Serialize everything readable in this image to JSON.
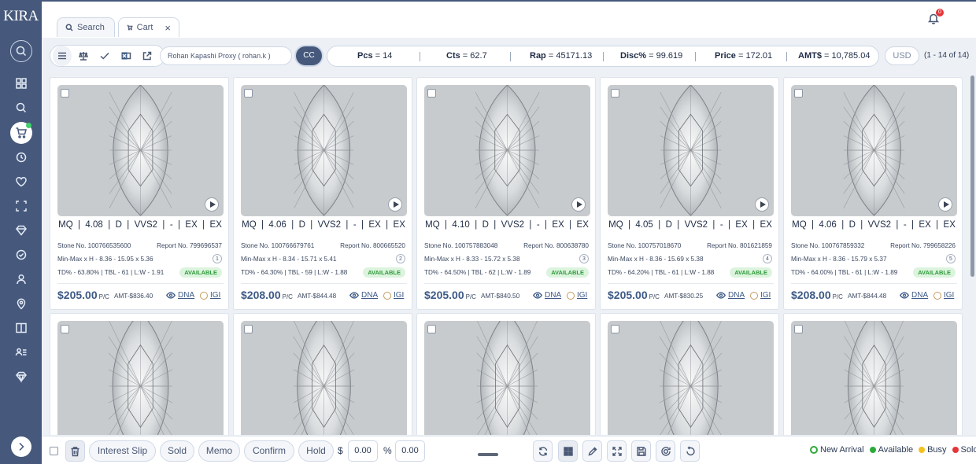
{
  "app": {
    "logo": "KIRA"
  },
  "tabs": [
    {
      "label": "Search"
    },
    {
      "label": "Cart"
    }
  ],
  "notifications": {
    "count": "0"
  },
  "toolbar": {
    "proxy_user": "Rohan Kapashi Proxy ( rohan.k )",
    "cc_label": "CC",
    "currency": "USD",
    "range": "(1 - 14 of 14)"
  },
  "summary": [
    {
      "label": "Pcs",
      "value": "14"
    },
    {
      "label": "Cts",
      "value": "62.7"
    },
    {
      "label": "Rap",
      "value": "45171.13"
    },
    {
      "label": "Disc%",
      "value": "99.619"
    },
    {
      "label": "Price",
      "value": "172.01"
    },
    {
      "label": "AMT$",
      "value": "10,785.04"
    }
  ],
  "cards": [
    {
      "spec": "MQ  |  4.08  |  D  |  VVS2  |  -  |  EX  |  EX",
      "stone": "Stone No. 100766535600",
      "report": "Report No. 799696537",
      "minmax": "Min-Max x H - 8.36 - 15.95 x 5.36",
      "index": "1",
      "td": "TD% - 63.80% | TBL - 61 | L:W - 1.91",
      "status": "AVAILABLE",
      "price": "$205.00",
      "pc": "P/C",
      "amt": "AMT-$836.40",
      "dna": "DNA",
      "lab": "IGI"
    },
    {
      "spec": "MQ  |  4.06  |  D  |  VVS2  |  -  |  EX  |  EX",
      "stone": "Stone No. 100766679761",
      "report": "Report No. 800665520",
      "minmax": "Min-Max x H - 8.34 - 15.71 x 5.41",
      "index": "2",
      "td": "TD% - 64.30% | TBL - 59 | L:W - 1.88",
      "status": "AVAILABLE",
      "price": "$208.00",
      "pc": "P/C",
      "amt": "AMT-$844.48",
      "dna": "DNA",
      "lab": "IGI"
    },
    {
      "spec": "MQ  |  4.10  |  D  |  VVS2  |  -  |  EX  |  EX",
      "stone": "Stone No. 100757883048",
      "report": "Report No. 800638780",
      "minmax": "Min-Max x H - 8.33 - 15.72 x 5.38",
      "index": "3",
      "td": "TD% - 64.50% | TBL - 62 | L:W - 1.89",
      "status": "AVAILABLE",
      "price": "$205.00",
      "pc": "P/C",
      "amt": "AMT-$840.50",
      "dna": "DNA",
      "lab": "IGI"
    },
    {
      "spec": "MQ  |  4.05  |  D  |  VVS2  |  -  |  EX  |  EX",
      "stone": "Stone No. 100757018670",
      "report": "Report No. 801621859",
      "minmax": "Min-Max x H - 8.36 - 15.69 x 5.38",
      "index": "4",
      "td": "TD% - 64.20% | TBL - 61 | L:W - 1.88",
      "status": "AVAILABLE",
      "price": "$205.00",
      "pc": "P/C",
      "amt": "AMT-$830.25",
      "dna": "DNA",
      "lab": "IGI"
    },
    {
      "spec": "MQ  |  4.06  |  D  |  VVS2  |  -  |  EX  |  EX",
      "stone": "Stone No. 100767859332",
      "report": "Report No. 799658226",
      "minmax": "Min-Max x H - 8.36 - 15.79 x 5.37",
      "index": "5",
      "td": "TD% - 64.00% | TBL - 61 | L:W - 1.89",
      "status": "AVAILABLE",
      "price": "$208.00",
      "pc": "P/C",
      "amt": "AMT-$844.48",
      "dna": "DNA",
      "lab": "IGI"
    }
  ],
  "footer": {
    "buttons": [
      "Interest Slip",
      "Sold",
      "Memo",
      "Confirm",
      "Hold"
    ],
    "dollar_label": "$",
    "dollar_value": "0.00",
    "percent_label": "%",
    "percent_value": "0.00",
    "legend": [
      {
        "label": "New Arrival",
        "color": "#2eaa3b"
      },
      {
        "label": "Available",
        "color": "#2eaa3b"
      },
      {
        "label": "Busy",
        "color": "#f4c21c"
      },
      {
        "label": "Sold",
        "color": "#e6353a"
      }
    ]
  }
}
